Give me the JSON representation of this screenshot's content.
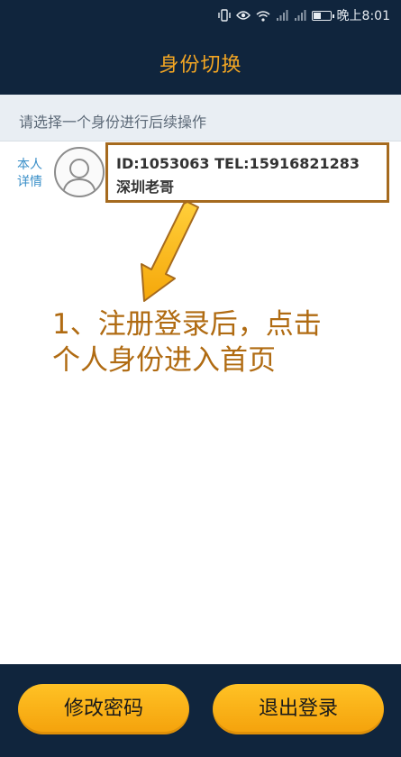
{
  "status_bar": {
    "time": "晚上8:01",
    "icons": [
      "vibrate-icon",
      "eye-icon",
      "wifi-icon",
      "signal-icon",
      "signal-icon",
      "battery-icon"
    ]
  },
  "header": {
    "title": "身份切换"
  },
  "hint": {
    "text": "请选择一个身份进行后续操作"
  },
  "identity": {
    "side_label": "本人详情",
    "id_line": "ID:1053063  TEL:15916821283",
    "name": "深圳老哥"
  },
  "annotation": {
    "line1": "1、注册登录后，点击",
    "line2": "个人身份进入首页"
  },
  "footer": {
    "change_password": "修改密码",
    "logout": "退出登录"
  },
  "colors": {
    "dark_bar": "#10253d",
    "accent_orange": "#f3a623",
    "annotation_brown": "#b06b12",
    "highlight_border": "#a56a1e",
    "link_blue": "#3a8fc8"
  }
}
